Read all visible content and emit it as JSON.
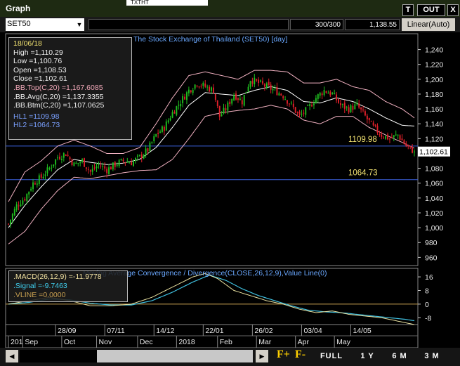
{
  "window": {
    "title": "Graph",
    "bg_tab": "TXTHT",
    "buttons": {
      "t": "T",
      "out": "OUT",
      "close": "X"
    }
  },
  "toolbar": {
    "symbol": "SET50",
    "bar_count": "300/300",
    "last_value": "1,138.55",
    "scale": "Linear(Auto)"
  },
  "main_chart": {
    "title": "The Stock Exchange of Thailand (SET50) [day]"
  },
  "info": {
    "date": "18/06/18",
    "high": "High   =1,110.29",
    "low": "Low    =1,100.76",
    "open": "Open   =1,108.53",
    "close": "Close  =1,102.61",
    "bb_top": ".BB.Top(C,20)   =1,167.6085",
    "bb_avg": ".BB.Avg(C,20)   =1,137.3355",
    "bb_btm": ".BB.Btm(C,20)   =1,107.0625",
    "hl1": "HL1 =1109.98",
    "hl2": "HL2 =1064.73"
  },
  "macd_info": {
    "title": "Moving Average Convergence / Divergence(CLOSE,26,12,9),Value Line(0)",
    "macd": ".MACD(26,12,9)   =-11.9778",
    "signal": ".Signal   =-9.7463",
    "vline": ".VLINE   =0.0000"
  },
  "bottom": {
    "full": "FULL",
    "y1": "1 Y",
    "m6": "6 M",
    "m3": "3 M",
    "f_plus": "F+",
    "f_minus": "F-",
    "left_arrow": "◀",
    "right_arrow": "▶"
  },
  "colors": {
    "up": "#1fbf1f",
    "down": "#e0202a",
    "bb_outer": "#f0b0c0",
    "bb_mid": "#ffffff",
    "hl": "#3a5fd8",
    "macd": "#e8e0a0",
    "signal": "#40c0e0",
    "vline": "#c8a050",
    "hl_text": "#f0e070"
  },
  "chart_data": {
    "type": "candlestick",
    "title": "The Stock Exchange of Thailand (SET50) [day]",
    "price_axis": {
      "ticks": [
        "1,240",
        "1,220",
        "1,200",
        "1,180",
        "1,160",
        "1,140",
        "1,120",
        "1,100",
        "1,080",
        "1,060",
        "1,040",
        "1,020",
        "1,000",
        "980",
        "960"
      ],
      "tick_values": [
        1240,
        1220,
        1200,
        1180,
        1160,
        1140,
        1120,
        1100,
        1080,
        1060,
        1040,
        1020,
        1000,
        980,
        960
      ],
      "ylim": [
        949,
        1250
      ]
    },
    "macd_axis": {
      "ticks": [
        "16",
        "8",
        "0",
        "-8"
      ],
      "tick_values": [
        16,
        8,
        0,
        -8
      ],
      "ylim": [
        -12,
        21
      ]
    },
    "date_labels": [
      {
        "label": "28/09",
        "bar": 23
      },
      {
        "label": "07/11",
        "bar": 47
      },
      {
        "label": "14/12",
        "bar": 71
      },
      {
        "label": "22/01",
        "bar": 95
      },
      {
        "label": "26/02",
        "bar": 119
      },
      {
        "label": "03/04",
        "bar": 143
      },
      {
        "label": "14/05",
        "bar": 167
      }
    ],
    "month_labels": [
      {
        "label": "201",
        "bar": 0
      },
      {
        "label": "Sep",
        "bar": 7
      },
      {
        "label": "Oct",
        "bar": 26
      },
      {
        "label": "Nov",
        "bar": 43
      },
      {
        "label": "Dec",
        "bar": 63
      },
      {
        "label": "2018",
        "bar": 82
      },
      {
        "label": "Feb",
        "bar": 102
      },
      {
        "label": "Mar",
        "bar": 121
      },
      {
        "label": "Apr",
        "bar": 140
      },
      {
        "label": "May",
        "bar": 159
      }
    ],
    "hl1": {
      "value": 1109.98,
      "label": "1109.98"
    },
    "hl2": {
      "value": 1064.73,
      "label": "1064.73"
    },
    "last_close_label": "1,102.61",
    "last_close": 1102.61,
    "close_anchors": [
      [
        0,
        1005
      ],
      [
        4,
        1030
      ],
      [
        8,
        1040
      ],
      [
        12,
        1060
      ],
      [
        16,
        1068
      ],
      [
        20,
        1080
      ],
      [
        24,
        1095
      ],
      [
        28,
        1100
      ],
      [
        32,
        1085
      ],
      [
        36,
        1090
      ],
      [
        40,
        1075
      ],
      [
        44,
        1085
      ],
      [
        48,
        1078
      ],
      [
        52,
        1085
      ],
      [
        56,
        1090
      ],
      [
        60,
        1088
      ],
      [
        64,
        1095
      ],
      [
        68,
        1105
      ],
      [
        72,
        1125
      ],
      [
        76,
        1135
      ],
      [
        80,
        1155
      ],
      [
        84,
        1170
      ],
      [
        88,
        1185
      ],
      [
        92,
        1195
      ],
      [
        96,
        1190
      ],
      [
        100,
        1185
      ],
      [
        103,
        1150
      ],
      [
        106,
        1160
      ],
      [
        110,
        1180
      ],
      [
        114,
        1170
      ],
      [
        118,
        1200
      ],
      [
        122,
        1195
      ],
      [
        126,
        1190
      ],
      [
        130,
        1185
      ],
      [
        134,
        1178
      ],
      [
        138,
        1165
      ],
      [
        142,
        1150
      ],
      [
        146,
        1160
      ],
      [
        150,
        1175
      ],
      [
        154,
        1185
      ],
      [
        158,
        1180
      ],
      [
        162,
        1165
      ],
      [
        166,
        1160
      ],
      [
        170,
        1165
      ],
      [
        174,
        1150
      ],
      [
        178,
        1135
      ],
      [
        182,
        1125
      ],
      [
        186,
        1120
      ],
      [
        190,
        1125
      ],
      [
        194,
        1110
      ],
      [
        198,
        1102.61
      ]
    ],
    "bb_top_anchors": [
      [
        0,
        1035
      ],
      [
        8,
        1075
      ],
      [
        16,
        1090
      ],
      [
        24,
        1110
      ],
      [
        32,
        1118
      ],
      [
        40,
        1110
      ],
      [
        48,
        1100
      ],
      [
        56,
        1100
      ],
      [
        64,
        1108
      ],
      [
        72,
        1140
      ],
      [
        80,
        1175
      ],
      [
        88,
        1205
      ],
      [
        96,
        1210
      ],
      [
        104,
        1205
      ],
      [
        112,
        1200
      ],
      [
        120,
        1212
      ],
      [
        128,
        1212
      ],
      [
        136,
        1210
      ],
      [
        144,
        1195
      ],
      [
        152,
        1195
      ],
      [
        160,
        1200
      ],
      [
        168,
        1190
      ],
      [
        176,
        1185
      ],
      [
        184,
        1170
      ],
      [
        192,
        1160
      ],
      [
        198,
        1148
      ]
    ],
    "bb_mid_anchors": [
      [
        0,
        1000
      ],
      [
        8,
        1030
      ],
      [
        16,
        1055
      ],
      [
        24,
        1078
      ],
      [
        32,
        1092
      ],
      [
        40,
        1088
      ],
      [
        48,
        1085
      ],
      [
        56,
        1087
      ],
      [
        64,
        1092
      ],
      [
        72,
        1108
      ],
      [
        80,
        1135
      ],
      [
        88,
        1165
      ],
      [
        96,
        1182
      ],
      [
        104,
        1180
      ],
      [
        112,
        1178
      ],
      [
        120,
        1185
      ],
      [
        128,
        1190
      ],
      [
        136,
        1185
      ],
      [
        144,
        1170
      ],
      [
        152,
        1168
      ],
      [
        160,
        1175
      ],
      [
        168,
        1170
      ],
      [
        176,
        1160
      ],
      [
        184,
        1148
      ],
      [
        192,
        1138
      ],
      [
        198,
        1137
      ]
    ],
    "bb_btm_anchors": [
      [
        0,
        978
      ],
      [
        8,
        995
      ],
      [
        16,
        1025
      ],
      [
        24,
        1050
      ],
      [
        32,
        1068
      ],
      [
        40,
        1066
      ],
      [
        48,
        1070
      ],
      [
        56,
        1074
      ],
      [
        64,
        1077
      ],
      [
        72,
        1078
      ],
      [
        80,
        1092
      ],
      [
        88,
        1120
      ],
      [
        96,
        1150
      ],
      [
        104,
        1155
      ],
      [
        112,
        1158
      ],
      [
        120,
        1160
      ],
      [
        128,
        1165
      ],
      [
        136,
        1160
      ],
      [
        144,
        1145
      ],
      [
        152,
        1140
      ],
      [
        160,
        1150
      ],
      [
        168,
        1150
      ],
      [
        176,
        1135
      ],
      [
        184,
        1125
      ],
      [
        192,
        1115
      ],
      [
        198,
        1107
      ]
    ],
    "macd_anchors": [
      [
        0,
        0
      ],
      [
        10,
        2
      ],
      [
        20,
        4
      ],
      [
        30,
        2
      ],
      [
        40,
        -1
      ],
      [
        50,
        -1
      ],
      [
        60,
        0
      ],
      [
        70,
        4
      ],
      [
        80,
        10
      ],
      [
        90,
        16
      ],
      [
        96,
        18
      ],
      [
        102,
        15
      ],
      [
        110,
        8
      ],
      [
        118,
        5
      ],
      [
        126,
        2
      ],
      [
        134,
        0
      ],
      [
        142,
        -3
      ],
      [
        150,
        -5
      ],
      [
        158,
        -4
      ],
      [
        166,
        -6
      ],
      [
        174,
        -7
      ],
      [
        182,
        -8
      ],
      [
        190,
        -10
      ],
      [
        198,
        -11.98
      ]
    ],
    "signal_anchors": [
      [
        0,
        0
      ],
      [
        10,
        1
      ],
      [
        20,
        3
      ],
      [
        30,
        2.5
      ],
      [
        40,
        0.5
      ],
      [
        50,
        -0.5
      ],
      [
        60,
        -0.5
      ],
      [
        70,
        2
      ],
      [
        80,
        7
      ],
      [
        90,
        13
      ],
      [
        98,
        17
      ],
      [
        106,
        14
      ],
      [
        114,
        9
      ],
      [
        122,
        5
      ],
      [
        130,
        2
      ],
      [
        138,
        -1
      ],
      [
        146,
        -3.5
      ],
      [
        154,
        -4.5
      ],
      [
        162,
        -5
      ],
      [
        170,
        -6
      ],
      [
        178,
        -7
      ],
      [
        186,
        -8
      ],
      [
        194,
        -9
      ],
      [
        198,
        -9.75
      ]
    ],
    "vline": 0,
    "bars": 199
  }
}
